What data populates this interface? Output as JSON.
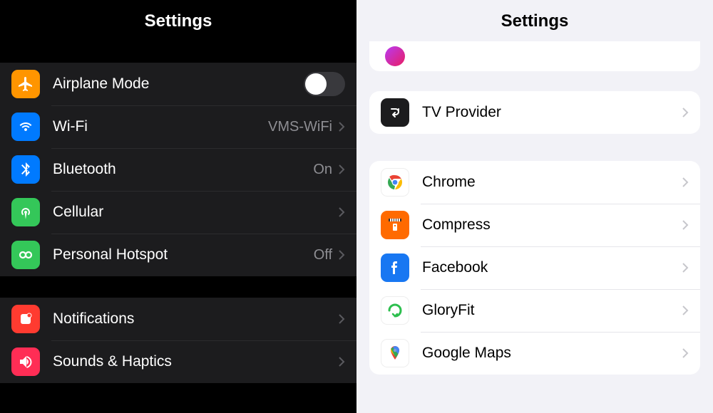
{
  "dark": {
    "title": "Settings",
    "rows": {
      "airplane": {
        "label": "Airplane Mode"
      },
      "wifi": {
        "label": "Wi-Fi",
        "value": "VMS-WiFi"
      },
      "bluetooth": {
        "label": "Bluetooth",
        "value": "On"
      },
      "cellular": {
        "label": "Cellular"
      },
      "hotspot": {
        "label": "Personal Hotspot",
        "value": "Off"
      },
      "notifications": {
        "label": "Notifications"
      },
      "sounds": {
        "label": "Sounds & Haptics"
      }
    }
  },
  "light": {
    "title": "Settings",
    "rows": {
      "tvprovider": {
        "label": "TV Provider"
      },
      "chrome": {
        "label": "Chrome"
      },
      "compress": {
        "label": "Compress"
      },
      "facebook": {
        "label": "Facebook"
      },
      "gloryfit": {
        "label": "GloryFit"
      },
      "googlemaps": {
        "label": "Google Maps"
      }
    }
  }
}
